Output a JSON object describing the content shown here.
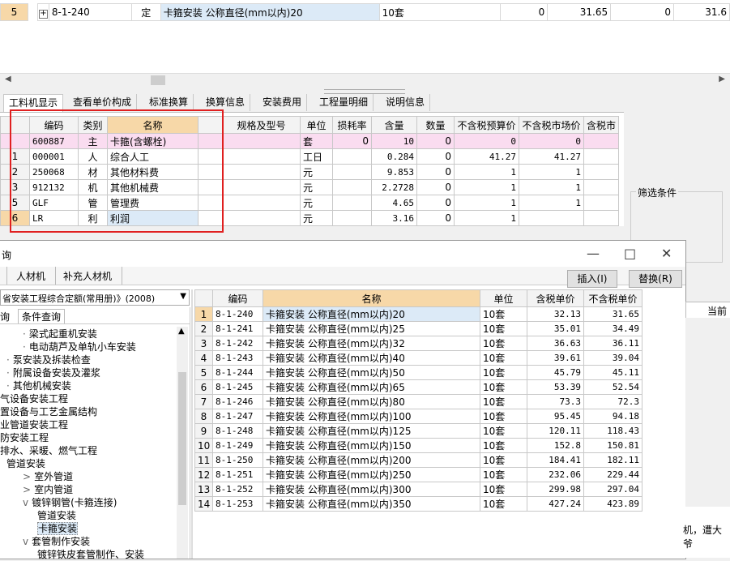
{
  "top_grid": {
    "row": {
      "index": "5",
      "expand": "+",
      "code": "8-1-240",
      "type": "定",
      "name": "卡箍安装 公称直径(mm以内)20",
      "unit": "10套",
      "v1": "0",
      "v2": "31.65",
      "v3": "0",
      "v4": "31.6"
    }
  },
  "tabs": [
    "工料机显示",
    "查看单价构成",
    "标准换算",
    "换算信息",
    "安装费用",
    "工程量明细",
    "说明信息"
  ],
  "materials": {
    "headers": [
      "编码",
      "类别",
      "名称",
      "规格及型号",
      "单位",
      "损耗率",
      "含量",
      "数量",
      "不含税预算价",
      "不含税市场价",
      "含税市"
    ],
    "rows": [
      {
        "num": "",
        "code": "600887",
        "type": "主",
        "name": "卡箍(含螺栓)",
        "spec": "",
        "unit": "套",
        "loss": "0",
        "qty": "10",
        "amount": "0",
        "budget": "0",
        "market": "0",
        "tax": ""
      },
      {
        "num": "1",
        "code": "000001",
        "type": "人",
        "name": "综合人工",
        "spec": "",
        "unit": "工日",
        "loss": "",
        "qty": "0.284",
        "amount": "0",
        "budget": "41.27",
        "market": "41.27",
        "tax": ""
      },
      {
        "num": "2",
        "code": "250068",
        "type": "材",
        "name": "其他材料费",
        "spec": "",
        "unit": "元",
        "loss": "",
        "qty": "9.853",
        "amount": "0",
        "budget": "1",
        "market": "1",
        "tax": ""
      },
      {
        "num": "3",
        "code": "912132",
        "type": "机",
        "name": "其他机械费",
        "spec": "",
        "unit": "元",
        "loss": "",
        "qty": "2.2728",
        "amount": "0",
        "budget": "1",
        "market": "1",
        "tax": ""
      },
      {
        "num": "5",
        "code": "GLF",
        "type": "管",
        "name": "管理费",
        "spec": "",
        "unit": "元",
        "loss": "",
        "qty": "4.65",
        "amount": "0",
        "budget": "1",
        "market": "1",
        "tax": ""
      },
      {
        "num": "6",
        "code": "LR",
        "type": "利",
        "name": "利润",
        "spec": "",
        "unit": "元",
        "loss": "",
        "qty": "3.16",
        "amount": "0",
        "budget": "1",
        "market": "",
        "tax": ""
      }
    ]
  },
  "filter": {
    "label": "筛选条件"
  },
  "dialog": {
    "title": "询",
    "tabs": [
      "人材机",
      "补充人材机"
    ],
    "insert_button": "插入(I)",
    "replace_button": "替换(R)",
    "combo_value": "省安装工程综合定额(常用册)》(2008)",
    "subtabs": [
      "询",
      "条件查询"
    ],
    "tree": [
      {
        "text": "梁式起重机安装",
        "indent": 28,
        "prefix": "·"
      },
      {
        "text": "电动葫芦及单轨小车安装",
        "indent": 28,
        "prefix": "·"
      },
      {
        "text": "泵安装及拆装检查",
        "indent": 8,
        "prefix": "·"
      },
      {
        "text": "附属设备安装及灌浆",
        "indent": 8,
        "prefix": "·"
      },
      {
        "text": "其他机械安装",
        "indent": 8,
        "prefix": "·"
      },
      {
        "text": "气设备安装工程",
        "indent": 0,
        "prefix": ""
      },
      {
        "text": "置设备与工艺金属结构",
        "indent": 0,
        "prefix": ""
      },
      {
        "text": "业管道安装工程",
        "indent": 0,
        "prefix": ""
      },
      {
        "text": "防安装工程",
        "indent": 0,
        "prefix": ""
      },
      {
        "text": "排水、采暖、燃气工程",
        "indent": 0,
        "prefix": ""
      },
      {
        "text": "管道安装",
        "indent": 8,
        "prefix": ""
      },
      {
        "text": "室外管道",
        "indent": 28,
        "prefix": ">"
      },
      {
        "text": "室内管道",
        "indent": 28,
        "prefix": ">"
      },
      {
        "text": "镀锌钢管(卡箍连接)",
        "indent": 28,
        "prefix": "v"
      },
      {
        "text": "管道安装",
        "indent": 46,
        "prefix": ""
      },
      {
        "text": "卡箍安装",
        "indent": 46,
        "prefix": "",
        "selected": true
      },
      {
        "text": "套管制作安装",
        "indent": 28,
        "prefix": "v"
      },
      {
        "text": "镀锌铁皮套管制作、安装",
        "indent": 46,
        "prefix": ""
      }
    ],
    "results": {
      "headers": [
        "",
        "编码",
        "名称",
        "单位",
        "含税单价",
        "不含税单价"
      ],
      "rows": [
        {
          "n": "1",
          "code": "8-1-240",
          "name": "卡箍安装 公称直径(mm以内)20",
          "unit": "10套",
          "tax": "32.13",
          "notax": "31.65"
        },
        {
          "n": "2",
          "code": "8-1-241",
          "name": "卡箍安装 公称直径(mm以内)25",
          "unit": "10套",
          "tax": "35.01",
          "notax": "34.49"
        },
        {
          "n": "3",
          "code": "8-1-242",
          "name": "卡箍安装 公称直径(mm以内)32",
          "unit": "10套",
          "tax": "36.63",
          "notax": "36.11"
        },
        {
          "n": "4",
          "code": "8-1-243",
          "name": "卡箍安装 公称直径(mm以内)40",
          "unit": "10套",
          "tax": "39.61",
          "notax": "39.04"
        },
        {
          "n": "5",
          "code": "8-1-244",
          "name": "卡箍安装 公称直径(mm以内)50",
          "unit": "10套",
          "tax": "45.79",
          "notax": "45.11"
        },
        {
          "n": "6",
          "code": "8-1-245",
          "name": "卡箍安装 公称直径(mm以内)65",
          "unit": "10套",
          "tax": "53.39",
          "notax": "52.54"
        },
        {
          "n": "7",
          "code": "8-1-246",
          "name": "卡箍安装 公称直径(mm以内)80",
          "unit": "10套",
          "tax": "73.3",
          "notax": "72.3"
        },
        {
          "n": "8",
          "code": "8-1-247",
          "name": "卡箍安装 公称直径(mm以内)100",
          "unit": "10套",
          "tax": "95.45",
          "notax": "94.18"
        },
        {
          "n": "9",
          "code": "8-1-248",
          "name": "卡箍安装 公称直径(mm以内)125",
          "unit": "10套",
          "tax": "120.11",
          "notax": "118.43"
        },
        {
          "n": "10",
          "code": "8-1-249",
          "name": "卡箍安装 公称直径(mm以内)150",
          "unit": "10套",
          "tax": "152.8",
          "notax": "150.81"
        },
        {
          "n": "11",
          "code": "8-1-250",
          "name": "卡箍安装 公称直径(mm以内)200",
          "unit": "10套",
          "tax": "184.41",
          "notax": "182.11"
        },
        {
          "n": "12",
          "code": "8-1-251",
          "name": "卡箍安装 公称直径(mm以内)250",
          "unit": "10套",
          "tax": "232.06",
          "notax": "229.44"
        },
        {
          "n": "13",
          "code": "8-1-252",
          "name": "卡箍安装 公称直径(mm以内)300",
          "unit": "10套",
          "tax": "299.98",
          "notax": "297.04"
        },
        {
          "n": "14",
          "code": "8-1-253",
          "name": "卡箍安装 公称直径(mm以内)350",
          "unit": "10套",
          "tax": "427.24",
          "notax": "423.89"
        }
      ]
    }
  },
  "side_labels": {
    "current": "当前",
    "bottom_text": "机，遭大爷"
  }
}
